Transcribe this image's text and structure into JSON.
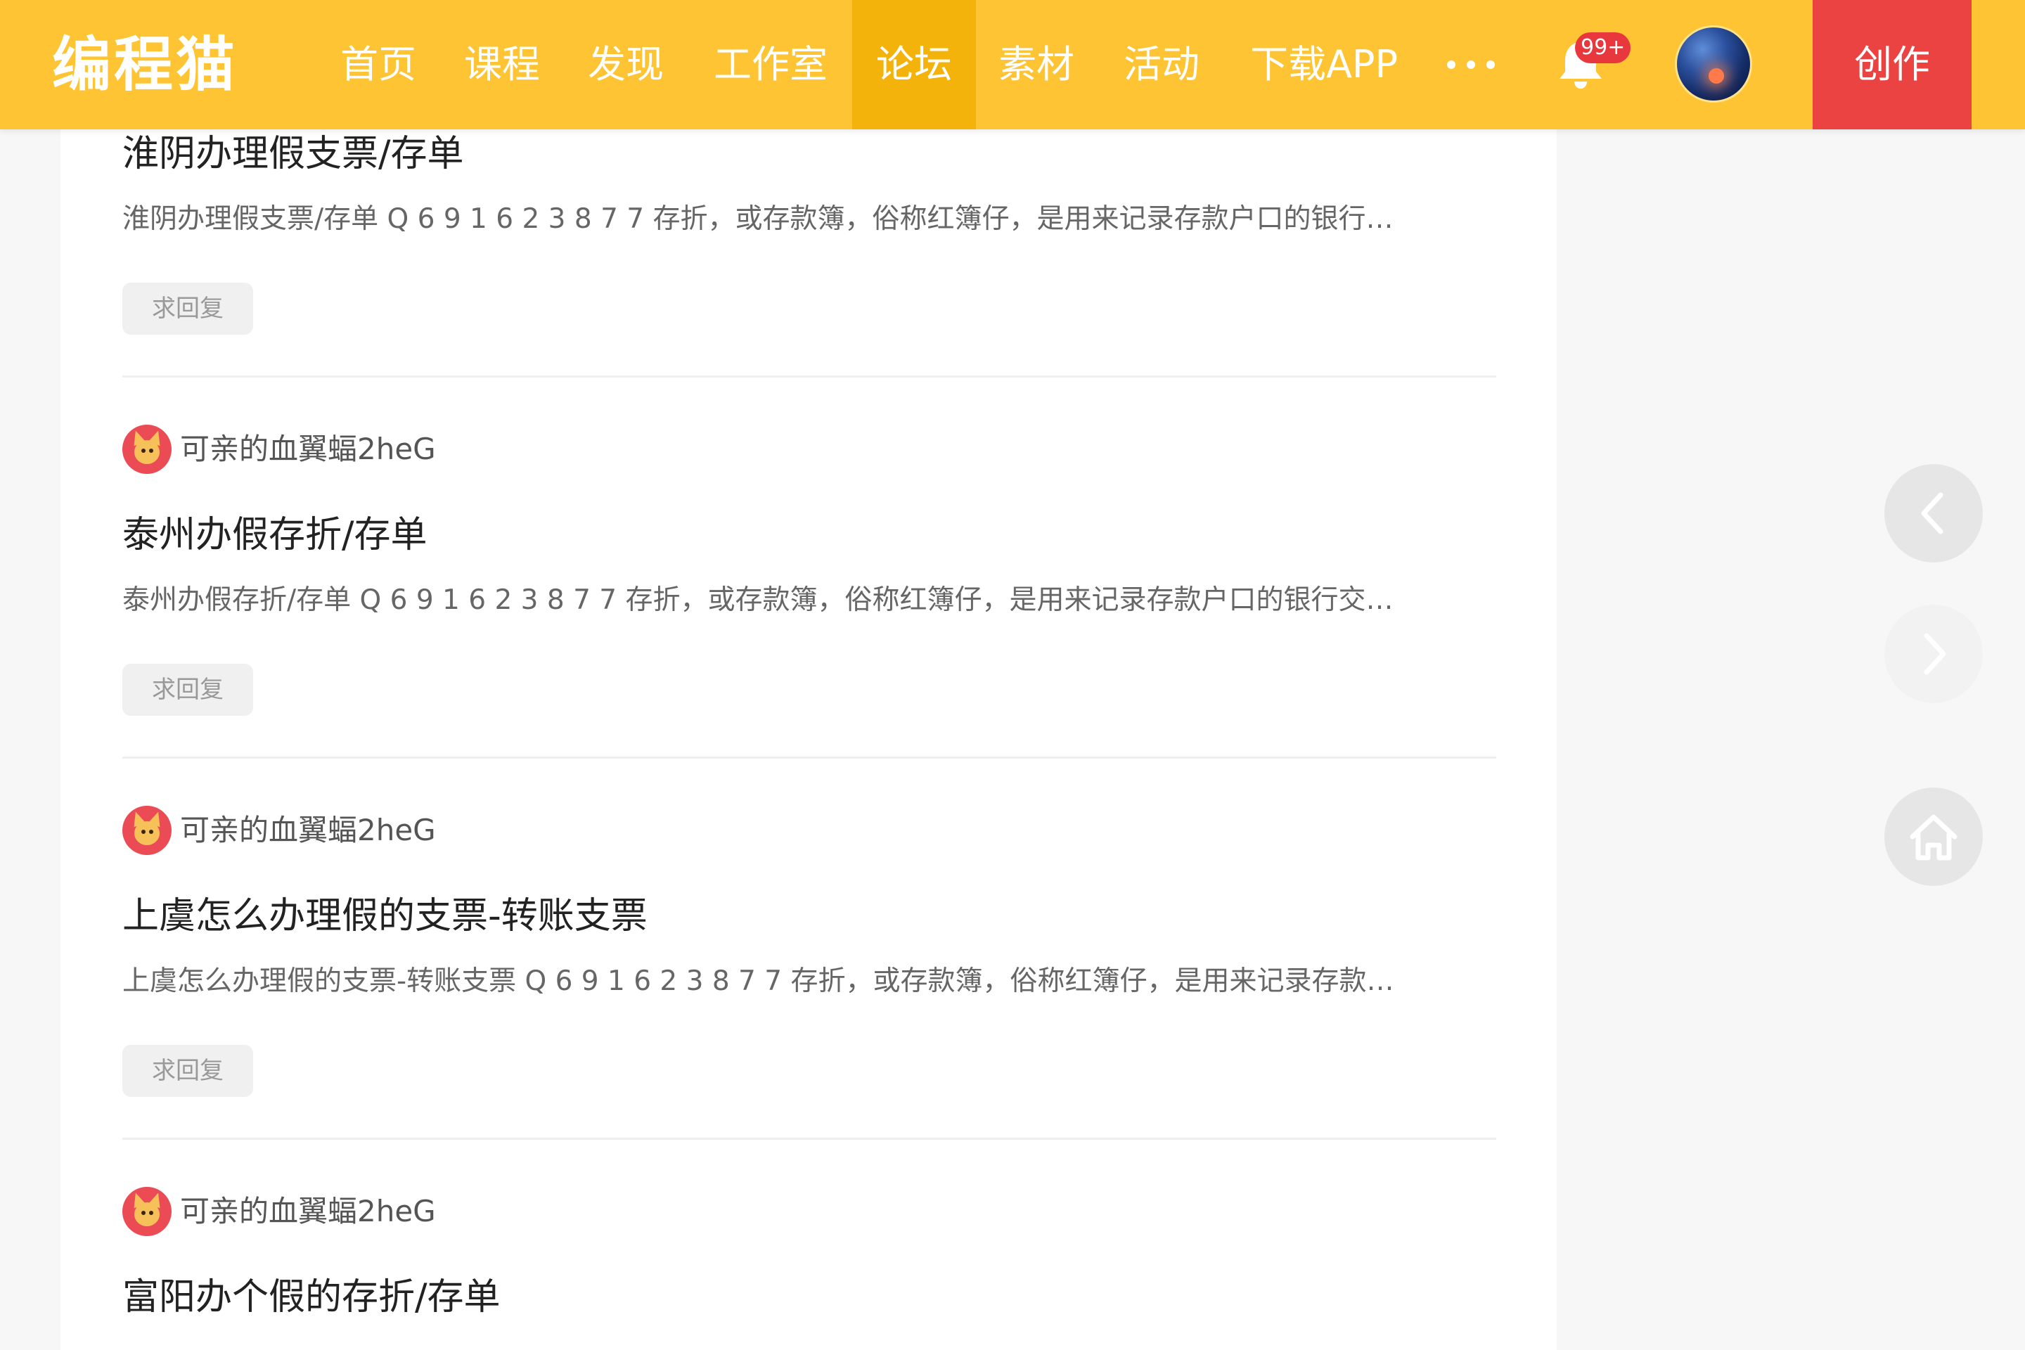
{
  "header": {
    "logo": "编程猫",
    "nav": [
      {
        "label": "首页",
        "active": false
      },
      {
        "label": "课程",
        "active": false
      },
      {
        "label": "发现",
        "active": false
      },
      {
        "label": "工作室",
        "active": false
      },
      {
        "label": "论坛",
        "active": true
      },
      {
        "label": "素材",
        "active": false
      },
      {
        "label": "活动",
        "active": false
      },
      {
        "label": "下载APP",
        "active": false
      }
    ],
    "more_icon": "more-dots-icon",
    "notifications": {
      "icon": "bell-icon",
      "badge": "99+"
    },
    "avatar_icon": "user-avatar",
    "create_label": "创作"
  },
  "posts": [
    {
      "author": "",
      "title": "淮阴办理假支票/存单",
      "summary": "淮阴办理假支票/存单 Q 6 9 1 6 2 3 8 7 7 存折，或存款簿，俗称红簿仔，是用来记录存款户口的银行…",
      "tag": "求回复"
    },
    {
      "author": "可亲的血翼蝠2heG",
      "title": "泰州办假存折/存单",
      "summary": "泰州办假存折/存单 Q 6 9 1 6 2 3 8 7 7 存折，或存款簿，俗称红簿仔，是用来记录存款户口的银行交…",
      "tag": "求回复"
    },
    {
      "author": "可亲的血翼蝠2heG",
      "title": "上虞怎么办理假的支票-转账支票",
      "summary": "上虞怎么办理假的支票-转账支票 Q 6 9 1 6 2 3 8 7 7 存折，或存款簿，俗称红簿仔，是用来记录存款…",
      "tag": "求回复"
    },
    {
      "author": "可亲的血翼蝠2heG",
      "title": "富阳办个假的存折/存单",
      "summary": "",
      "tag": ""
    }
  ],
  "side_buttons": [
    {
      "icon": "chevron-left-icon",
      "enabled": true
    },
    {
      "icon": "chevron-right-icon",
      "enabled": false
    },
    {
      "icon": "home-icon",
      "enabled": true
    }
  ],
  "colors": {
    "topbar": "#fec433",
    "nav_active": "#f4b30a",
    "create_button": "#eb4242",
    "badge": "#e8383d",
    "page_background": "#f7f7f7"
  }
}
